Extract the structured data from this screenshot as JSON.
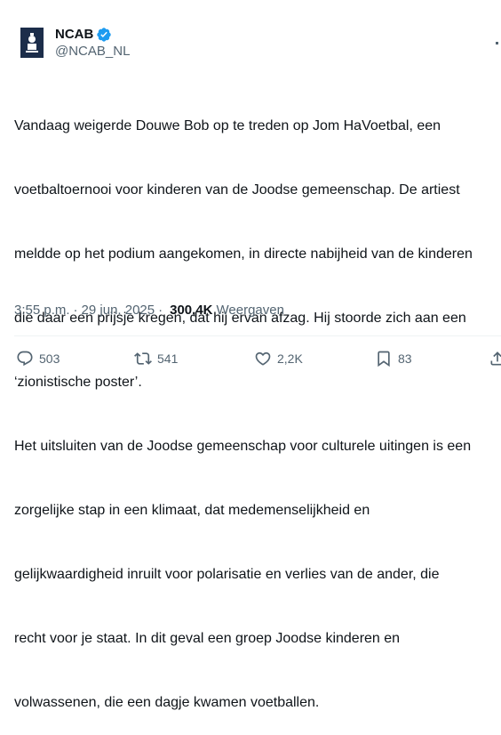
{
  "author": {
    "display_name": "NCAB",
    "handle": "@NCAB_NL",
    "verified": true,
    "verified_color": "#1d9bf0",
    "avatar_icon": "ncab-logo"
  },
  "tweet": {
    "lines": [
      "Vandaag weigerde Douwe Bob op te treden op Jom HaVoetbal, een",
      "voetbaltoernooi voor kinderen van de Joodse gemeenschap. De artiest",
      "meldde op het podium aangekomen, in directe nabijheid van de kinderen",
      "die daar een prijsje kregen, dat hij ervan afzag. Hij stoorde zich aan een",
      "‘zionistische poster’.",
      "Het uitsluiten van de Joodse gemeenschap voor culturele uitingen is een",
      "zorgelijke stap in een klimaat, dat medemenselijkheid en",
      "gelijkwaardigheid inruilt voor polarisatie en verlies van de ander, die",
      "recht voor je staat. In dit geval een groep Joodse kinderen en",
      "volwassenen, die een dagje kwamen voetballen."
    ]
  },
  "meta": {
    "time": "3:55 p.m.",
    "separator": "·",
    "date": "29 jun. 2025",
    "separator2": "·",
    "views_count": "300,4K",
    "views_label": "Weergaven"
  },
  "actions": {
    "replies": "503",
    "reposts": "541",
    "likes": "2,2K",
    "bookmarks": "83"
  }
}
